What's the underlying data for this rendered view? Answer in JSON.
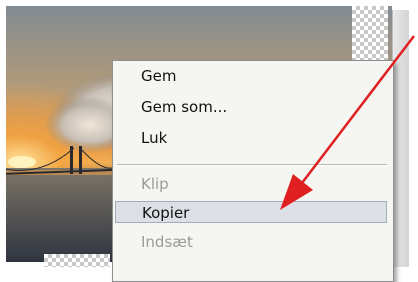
{
  "context_menu": {
    "items": [
      {
        "label": "Gem",
        "state": "enabled"
      },
      {
        "label": "Gem som...",
        "state": "enabled"
      },
      {
        "label": "Luk",
        "state": "enabled"
      },
      {
        "label": "Klip",
        "state": "disabled"
      },
      {
        "label": "Kopier",
        "state": "highlighted"
      },
      {
        "label": "Indsæt",
        "state": "disabled"
      },
      {
        "label": "",
        "state": "partially-hidden"
      }
    ]
  },
  "annotation": {
    "arrow_color": "#e02020"
  },
  "colors": {
    "menu_background": "#f5f5f2",
    "menu_highlight": "#dcdfe6",
    "disabled_text": "#9b9b9b"
  }
}
